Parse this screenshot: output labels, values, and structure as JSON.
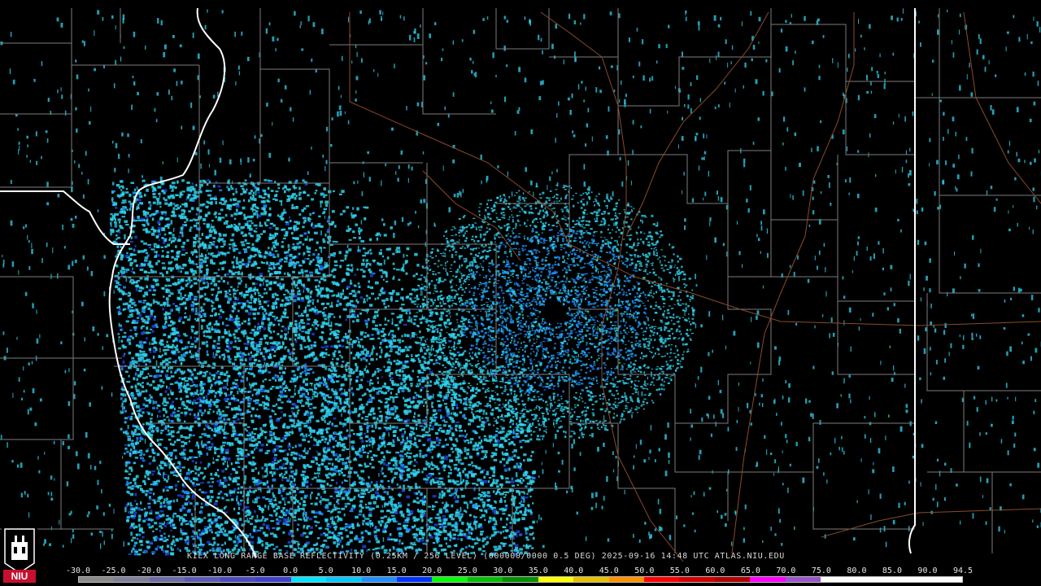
{
  "product": {
    "title": "KILX LONG RANGE BASE REFLECTIVITY (0.25KM / 256 LEVEL) (000000/0000 0.5 DEG) 2025-09-16 14:48 UTC  ATLAS.NIU.EDU"
  },
  "logo": {
    "text": "NIU",
    "color": "#c8102e"
  },
  "colors": {
    "background": "#000000",
    "county_lines": "#8a8a8a",
    "state_lines": "#ffffff",
    "highways": "#8b4a2b",
    "echo_light": "#2fd3ef",
    "echo_mid": "#1e90ff",
    "echo_heavy": "#2040d0",
    "echo_green": "#22c55e"
  },
  "scale": {
    "labels": [
      "-30.0",
      "-25.0",
      "-20.0",
      "-15.0",
      "-10.0",
      "-5.0",
      "0.0",
      "5.0",
      "10.0",
      "15.0",
      "20.0",
      "25.0",
      "30.0",
      "35.0",
      "40.0",
      "45.0",
      "50.0",
      "55.0",
      "60.0",
      "65.0",
      "70.0",
      "75.0",
      "80.0",
      "85.0",
      "90.0",
      "94.5"
    ],
    "colors": [
      "#8a8a8a",
      "#7f7f9a",
      "#6c6ca8",
      "#5a5ab5",
      "#4a4ac0",
      "#4040d0",
      "#00e5ff",
      "#00c8ff",
      "#1e90ff",
      "#0033ff",
      "#00ff00",
      "#00c000",
      "#009000",
      "#ffff00",
      "#e7c000",
      "#ff9000",
      "#ff0000",
      "#d00000",
      "#b00000",
      "#ff00ff",
      "#9955c9",
      "#ffffff",
      "#ffffff",
      "#ffffff",
      "#ffffff"
    ]
  }
}
